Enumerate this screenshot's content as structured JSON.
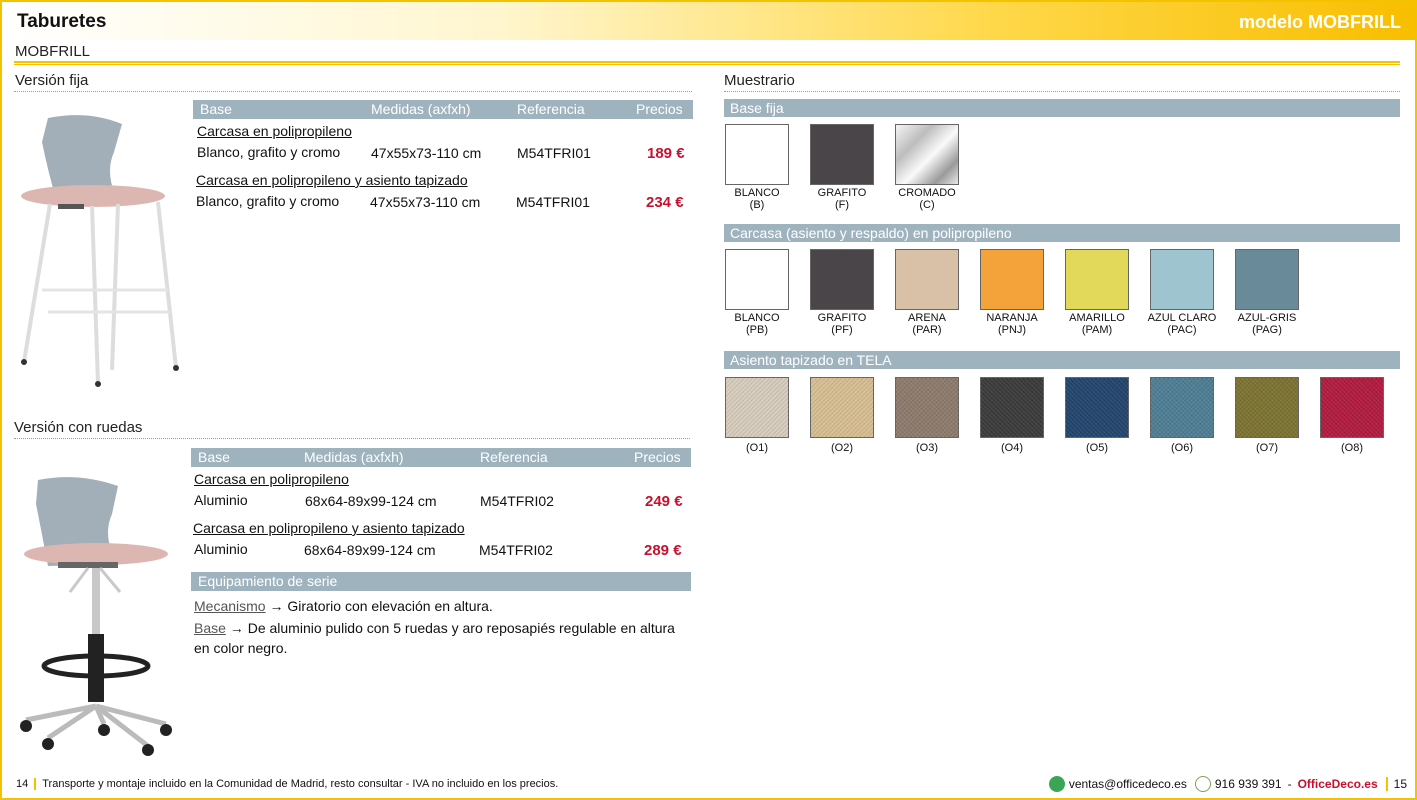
{
  "header": {
    "title": "Taburetes",
    "model": "modelo MOBFRILL"
  },
  "subtitle": "MOBFRILL",
  "fixed": {
    "title": "Versión fija",
    "headers": [
      "Base",
      "Medidas (axfxh)",
      "Referencia",
      "Precios"
    ],
    "groups": [
      {
        "name": "Carcasa en polipropileno",
        "base": "Blanco, grafito y cromo",
        "size": "47x55x73-110 cm",
        "ref": "M54TFRI01",
        "price": "189 €"
      },
      {
        "name": "Carcasa en polipropileno y asiento tapizado",
        "base": "Blanco, grafito y cromo",
        "size": "47x55x73-110 cm",
        "ref": "M54TFRI01",
        "price": "234 €"
      }
    ]
  },
  "wheels": {
    "title": "Versión con ruedas",
    "headers": [
      "Base",
      "Medidas (axfxh)",
      "Referencia",
      "Precios"
    ],
    "groups": [
      {
        "name": "Carcasa en polipropileno",
        "base": "Aluminio",
        "size": "68x64-89x99-124 cm",
        "ref": "M54TFRI02",
        "price": "249 €"
      },
      {
        "name": "Carcasa en polipropileno y asiento tapizado",
        "base": "Aluminio",
        "size": "68x64-89x99-124 cm",
        "ref": "M54TFRI02",
        "price": "289 €"
      }
    ],
    "equip_title": "Equipamiento de serie",
    "equip": [
      {
        "label": "Mecanismo",
        "arrow": " → ",
        "text": "Giratorio con elevación en altura."
      },
      {
        "label": "Base",
        "arrow": " → ",
        "text": "De aluminio pulido con 5 ruedas y aro reposapiés regulable en altura en color negro."
      }
    ]
  },
  "samples": {
    "title": "Muestrario",
    "base": {
      "title": "Base fija",
      "items": [
        {
          "name": "BLANCO",
          "code": "(B)",
          "color": "#ffffff"
        },
        {
          "name": "GRAFITO",
          "code": "(F)",
          "color": "#4a4549"
        },
        {
          "name": "CROMADO",
          "code": "(C)",
          "color": "#d6d6d6"
        }
      ]
    },
    "shell": {
      "title": "Carcasa (asiento y respaldo) en polipropileno",
      "items": [
        {
          "name": "BLANCO",
          "code": "(PB)",
          "color": "#ffffff"
        },
        {
          "name": "GRAFITO",
          "code": "(PF)",
          "color": "#4a4549"
        },
        {
          "name": "ARENA",
          "code": "(PAR)",
          "color": "#d8c1a6"
        },
        {
          "name": "NARANJA",
          "code": "(PNJ)",
          "color": "#f4a23a"
        },
        {
          "name": "AMARILLO",
          "code": "(PAM)",
          "color": "#e2d95a"
        },
        {
          "name": "AZUL CLARO",
          "code": "(PAC)",
          "color": "#9ec4cf"
        },
        {
          "name": "AZUL-GRIS",
          "code": "(PAG)",
          "color": "#698a99"
        }
      ]
    },
    "fabric": {
      "title": "Asiento tapizado en TELA",
      "items": [
        {
          "code": "(O1)",
          "color": "#d7cdbd"
        },
        {
          "code": "(O2)",
          "color": "#d8bf92"
        },
        {
          "code": "(O3)",
          "color": "#8e7c6d"
        },
        {
          "code": "(O4)",
          "color": "#3c3c3c"
        },
        {
          "code": "(O5)",
          "color": "#24466e"
        },
        {
          "code": "(O6)",
          "color": "#4f7f95"
        },
        {
          "code": "(O7)",
          "color": "#7d7432"
        },
        {
          "code": "(O8)",
          "color": "#b21c3f"
        }
      ]
    }
  },
  "footer": {
    "page_left": "14",
    "note": "Transporte y montaje incluido en la Comunidad de Madrid, resto consultar - IVA no incluido en los precios.",
    "email": "ventas@officedeco.es",
    "phone": "916 939 391",
    "sep": "-",
    "brand": "OfficeDeco.es",
    "page_right": "15"
  },
  "colors": {
    "accent": "#f3c300",
    "header_band": "#9fb3bf",
    "price": "#c8102e"
  }
}
